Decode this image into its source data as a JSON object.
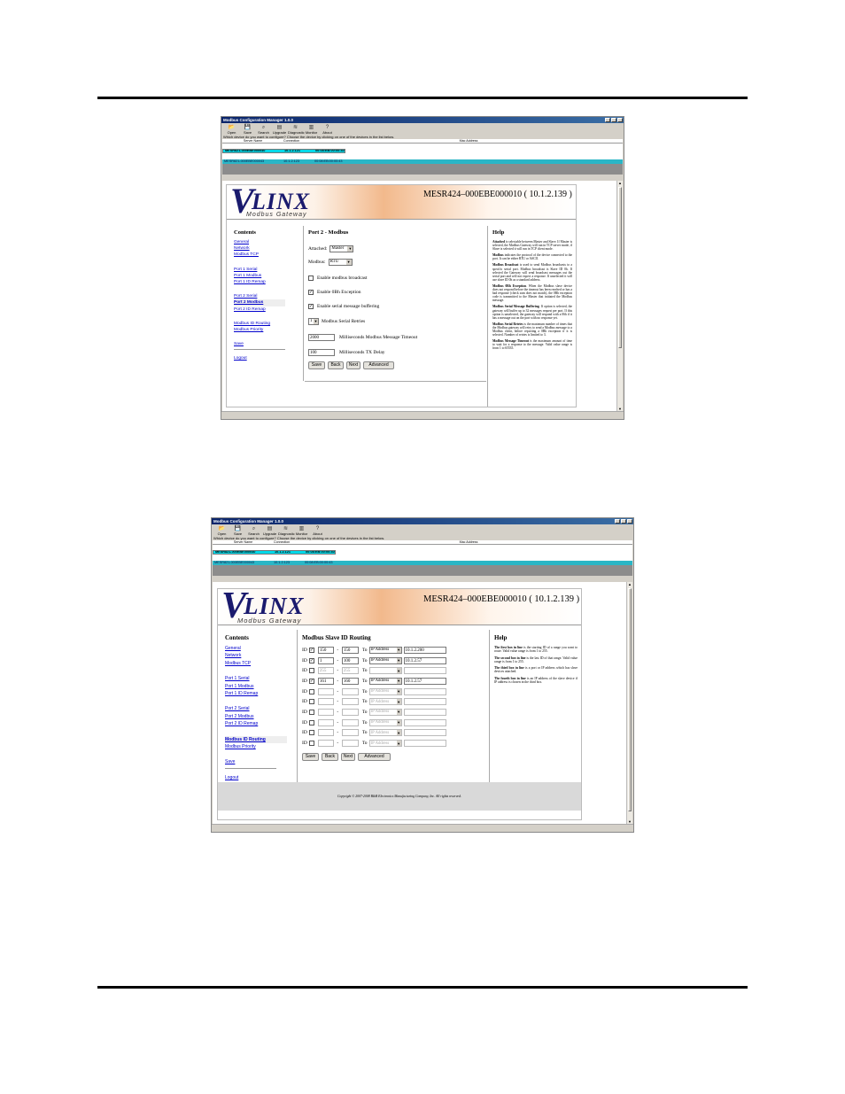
{
  "app": {
    "title": "Modbus Configuration Manager 1.0.0",
    "toolbar": [
      "Open",
      "Save",
      "Search",
      "Upgrade",
      "Diagnostic",
      "Monitor",
      "About"
    ],
    "question": "Which device do you want to configure? Choose the device by clicking on one of the devices in the list below.",
    "columns": [
      "Server Name",
      "Connection",
      "Mac Address"
    ],
    "devices": [
      {
        "name": "MESR821-000EBE000040",
        "connection": "10.1.2.121",
        "mac": "00:08:EB:00:00:40"
      },
      {
        "name": "MESR821-000EBE000043",
        "connection": "10.1.2.123",
        "mac": "00:08:EB:00:00:43"
      }
    ]
  },
  "page": {
    "logo": "LINX",
    "logo_v": "V",
    "logo_sub": "Modbus Gateway",
    "device_title": "MESR424–000EBE000010 ( 10.1.2.139 )",
    "contents_title": "Contents",
    "nav": {
      "general": "General",
      "network": "Network",
      "modbus_tcp": "Modbus TCP",
      "port1_serial": "Port 1 Serial",
      "port1_modbus": "Port 1 Modbus",
      "port1_remap": "Port 1 ID Remap",
      "port2_serial": "Port 2 Serial",
      "port2_modbus": "Port 2 Modbus",
      "port2_remap": "Port 2 ID Remap",
      "routing": "Modbus ID Routing",
      "priority": "Modbus Priority",
      "save": "Save",
      "logout": "Logout"
    },
    "help_title": "Help",
    "buttons": {
      "save": "Save",
      "back": "Back",
      "next": "Next",
      "advanced": "Advanced"
    }
  },
  "screen1": {
    "section_title": "Port 2 - Modbus",
    "attached_label": "Attached:",
    "attached_value": "Master",
    "modbus_label": "Modbus:",
    "modbus_value": "RTU",
    "broadcast_label": "Enable modbus broadcast",
    "broadcast_checked": false,
    "exception_label": "Enable 0Bh Exception",
    "exception_checked": true,
    "buffering_label": "Enable serial message buffering",
    "buffering_checked": true,
    "retries_value": "1",
    "retries_label": "Modbus Serial Retries",
    "timeout_value": "2000",
    "timeout_label": "Milliseconds Modbus Message Timeout",
    "txdelay_value": "100",
    "txdelay_label": "Milliseconds TX Delay",
    "help": [
      {
        "b": "Attached",
        "t": " is selectable between Master and Slave. If Master is selected, the Modbus Gateway will run in TCP server mode, if Slave is selected it will run in TCP client mode."
      },
      {
        "b": "Modbus",
        "t": " indicates the protocol of the device connected to the port. It can be either RTU or ASCII."
      },
      {
        "b": "Modbus Broadcast",
        "t": " is used to send Modbus broadcasts to a specific serial port. Modbus broadcast is Slave ID 0h. If selected the Gateway will send broadcast messages out the serial port and will not expect a response. If unselected it will use slave ID 0h as a standard address."
      },
      {
        "b": "Modbus 0Bh Exception",
        "t": ". When the Modbus slave device does not respond before the timeout has been reached or has a bad response (check sum does not match), the 0Bh exception code is transmitted to the Master that initiated the Modbus message."
      },
      {
        "b": "Modbus Serial Message Buffering",
        "t": ". If option is selected, the gateway will buffer up to 32 messages request per port. If this option is unselected, the gateway will respond with a 06h if it has a message out on the port with no response yet."
      },
      {
        "b": "Modbus Serial Retries",
        "t": " is the maximum number of times that the Modbus gateway will retry to send a Modbus message to a Modbus client, before reporting a 0Bh exception if it is selected. Number of retries is limited to 3."
      },
      {
        "b": "Modbus Message Timeout",
        "t": " is the maximum amount of time to wait for a response to the message. Valid value range is from 1 to 65535."
      }
    ]
  },
  "screen2": {
    "section_title": "Modbus Slave ID Routing",
    "id_label": "ID",
    "to_label": "To",
    "dash": "-",
    "routes": [
      {
        "checked": true,
        "from": "150",
        "to": "150",
        "type": "IP Address",
        "ip": "10.1.2.200",
        "enabled": true
      },
      {
        "checked": true,
        "from": "1",
        "to": "100",
        "type": "IP Address",
        "ip": "10.1.2.57",
        "enabled": true
      },
      {
        "checked": false,
        "from": "255",
        "to": "255",
        "type": "",
        "ip": "",
        "enabled": false
      },
      {
        "checked": true,
        "from": "161",
        "to": "160",
        "type": "IP Address",
        "ip": "10.1.2.57",
        "enabled": true
      },
      {
        "checked": false,
        "from": "",
        "to": "",
        "type": "IP Address",
        "ip": "",
        "enabled": false
      },
      {
        "checked": false,
        "from": "",
        "to": "",
        "type": "IP Address",
        "ip": "",
        "enabled": false
      },
      {
        "checked": false,
        "from": "",
        "to": "",
        "type": "IP Address",
        "ip": "",
        "enabled": false
      },
      {
        "checked": false,
        "from": "",
        "to": "",
        "type": "IP Address",
        "ip": "",
        "enabled": false
      },
      {
        "checked": false,
        "from": "",
        "to": "",
        "type": "IP Address",
        "ip": "",
        "enabled": false
      },
      {
        "checked": false,
        "from": "",
        "to": "",
        "type": "IP Address",
        "ip": "",
        "enabled": false
      }
    ],
    "help": [
      {
        "b": "The first box in line",
        "t": " is the starting ID of a range you want to route. Valid value range is from 1 to 255."
      },
      {
        "b": "The second box in line",
        "t": " is the last ID of that range. Valid value range is from 1 to 255."
      },
      {
        "b": "The third box in line",
        "t": " is a port or IP address which has slave devices attached."
      },
      {
        "b": "The fourth box in line",
        "t": " is an IP address of the slave device if IP address is chosen in the third box."
      }
    ],
    "copyright": "Copyright © 2007-2008 B&B Electronics Manufacturing Company, Inc. All rights reserved."
  },
  "colors": {
    "selected_row": "#00d8e8",
    "other_row": "#2ab6c6",
    "link": "#0000cc",
    "titlebar": "#0a246a"
  }
}
